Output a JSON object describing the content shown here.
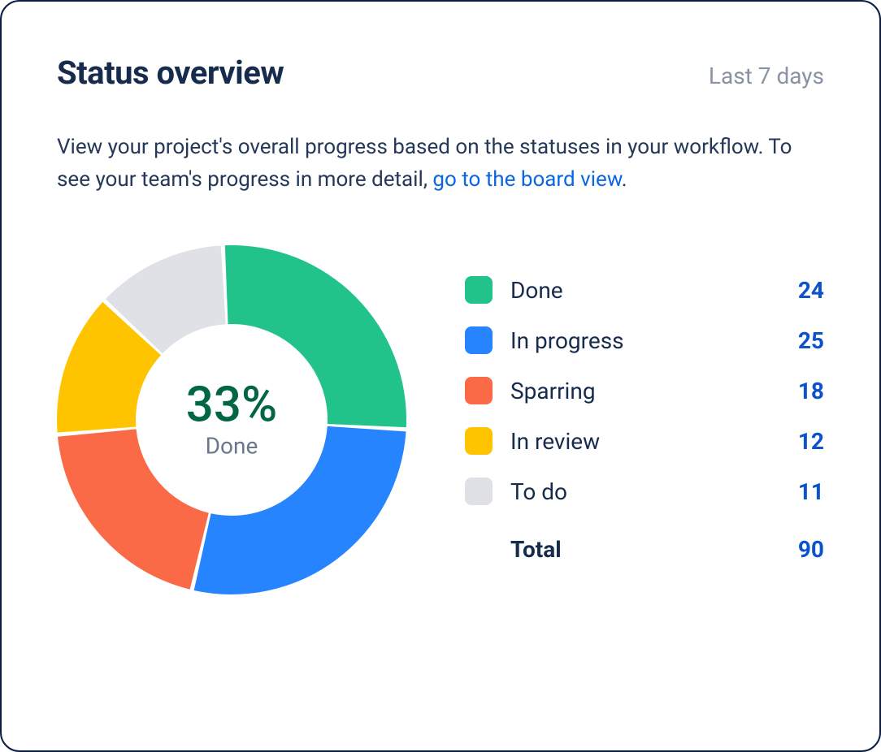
{
  "header": {
    "title": "Status overview",
    "range": "Last 7 days"
  },
  "description": {
    "text_before": "View your project's overall progress based on the statuses in your workflow. To see your team's progress in more detail, ",
    "link_text": "go to the board view",
    "text_after": "."
  },
  "donut": {
    "center_percent": "33%",
    "center_label": "Done"
  },
  "legend": {
    "items": [
      {
        "label": "Done",
        "value": "24",
        "color": "#22C38A"
      },
      {
        "label": "In progress",
        "value": "25",
        "color": "#2684FF"
      },
      {
        "label": "Sparring",
        "value": "18",
        "color": "#FA6A47"
      },
      {
        "label": "In review",
        "value": "12",
        "color": "#FFC400"
      },
      {
        "label": "To do",
        "value": "11",
        "color": "#DFE1E6"
      }
    ],
    "total_label": "Total",
    "total_value": "90"
  },
  "chart_data": {
    "type": "pie",
    "title": "Status overview",
    "series": [
      {
        "name": "Done",
        "value": 24,
        "color": "#22C38A"
      },
      {
        "name": "In progress",
        "value": 25,
        "color": "#2684FF"
      },
      {
        "name": "Sparring",
        "value": 18,
        "color": "#FA6A47"
      },
      {
        "name": "In review",
        "value": 12,
        "color": "#FFC400"
      },
      {
        "name": "To do",
        "value": 11,
        "color": "#DFE1E6"
      }
    ],
    "total": 90,
    "center_annotation": {
      "percent": 33,
      "label": "Done"
    },
    "donut": true
  }
}
